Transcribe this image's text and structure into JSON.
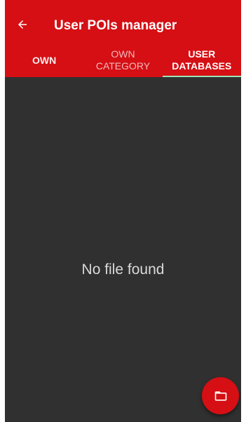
{
  "colors": {
    "app_bar": "#d50f14",
    "background": "#303030",
    "tab_indicator": "#9be3b5",
    "fab": "#d50f14"
  },
  "toolbar": {
    "back_icon": "arrow-left-icon",
    "title": "User POIs manager"
  },
  "tabs": [
    {
      "line1": "OWN",
      "line2": "",
      "active": false
    },
    {
      "line1": "OWN",
      "line2": "CATEGORY",
      "active": false
    },
    {
      "line1": "USER",
      "line2": "DATABASES",
      "active": true
    }
  ],
  "main": {
    "empty_message": "No file found"
  },
  "fab": {
    "icon": "folder-icon"
  }
}
